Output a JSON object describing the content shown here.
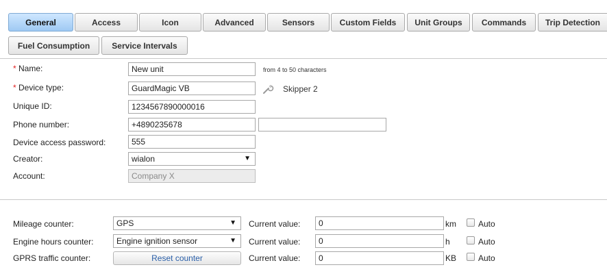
{
  "tabs_row1": [
    {
      "label": "General",
      "active": true
    },
    {
      "label": "Access"
    },
    {
      "label": "Icon"
    },
    {
      "label": "Advanced"
    },
    {
      "label": "Sensors"
    },
    {
      "label": "Custom Fields"
    },
    {
      "label": "Unit Groups"
    },
    {
      "label": "Commands"
    },
    {
      "label": "Trip Detection"
    }
  ],
  "tabs_row2": [
    {
      "label": "Fuel Consumption"
    },
    {
      "label": "Service Intervals"
    }
  ],
  "form": {
    "required_mark": "*",
    "name": {
      "label": "Name:",
      "value": "New unit",
      "hint": "from 4 to 50 characters"
    },
    "device_type": {
      "label": "Device type:",
      "value": "GuardMagic VB",
      "device_model": "Skipper 2"
    },
    "unique_id": {
      "label": "Unique ID:",
      "value": "1234567890000016"
    },
    "phone": {
      "label": "Phone number:",
      "value": "+4890235678",
      "value2": ""
    },
    "password": {
      "label": "Device access password:",
      "value": "555"
    },
    "creator": {
      "label": "Creator:",
      "value": "wialon"
    },
    "account": {
      "label": "Account:",
      "value": "Company X"
    }
  },
  "counters": {
    "current_value_label": "Current value:",
    "auto_label": "Auto",
    "mileage": {
      "label": "Mileage counter:",
      "select": "GPS",
      "value": "0",
      "unit": "km"
    },
    "engine": {
      "label": "Engine hours counter:",
      "select": "Engine ignition sensor",
      "value": "0",
      "unit": "h"
    },
    "gprs": {
      "label": "GPRS traffic counter:",
      "button": "Reset counter",
      "value": "0",
      "unit": "KB"
    }
  },
  "icons": {
    "dropdown_arrow": "▼",
    "wrench": "wrench-icon"
  }
}
